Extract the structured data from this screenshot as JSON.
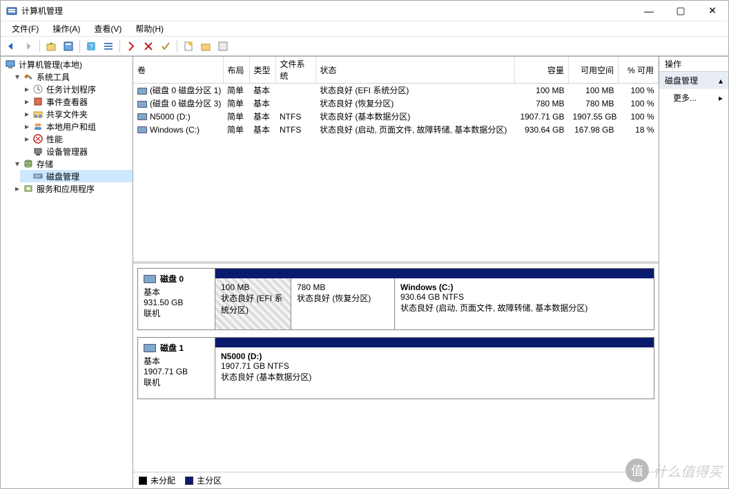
{
  "window": {
    "title": "计算机管理",
    "buttons": {
      "min": "—",
      "max": "▢",
      "close": "✕"
    }
  },
  "menu": {
    "file": "文件(F)",
    "action": "操作(A)",
    "view": "查看(V)",
    "help": "帮助(H)"
  },
  "tree": {
    "root": "计算机管理(本地)",
    "system_tools": "系统工具",
    "task_scheduler": "任务计划程序",
    "event_viewer": "事件查看器",
    "shared_folders": "共享文件夹",
    "local_users": "本地用户和组",
    "performance": "性能",
    "device_manager": "设备管理器",
    "storage": "存储",
    "disk_management": "磁盘管理",
    "services_apps": "服务和应用程序"
  },
  "columns": {
    "volume": "卷",
    "layout": "布局",
    "type": "类型",
    "filesystem": "文件系统",
    "status": "状态",
    "capacity": "容量",
    "free": "可用空间",
    "pct_free": "% 可用"
  },
  "volumes": [
    {
      "name": "(磁盘 0 磁盘分区 1)",
      "layout": "简单",
      "type": "基本",
      "fs": "",
      "status": "状态良好 (EFI 系统分区)",
      "capacity": "100 MB",
      "free": "100 MB",
      "pct": "100 %"
    },
    {
      "name": "(磁盘 0 磁盘分区 3)",
      "layout": "简单",
      "type": "基本",
      "fs": "",
      "status": "状态良好 (恢复分区)",
      "capacity": "780 MB",
      "free": "780 MB",
      "pct": "100 %"
    },
    {
      "name": "N5000 (D:)",
      "layout": "简单",
      "type": "基本",
      "fs": "NTFS",
      "status": "状态良好 (基本数据分区)",
      "capacity": "1907.71 GB",
      "free": "1907.55 GB",
      "pct": "100 %"
    },
    {
      "name": "Windows (C:)",
      "layout": "简单",
      "type": "基本",
      "fs": "NTFS",
      "status": "状态良好 (启动, 页面文件, 故障转储, 基本数据分区)",
      "capacity": "930.64 GB",
      "free": "167.98 GB",
      "pct": "18 %"
    }
  ],
  "disks": [
    {
      "name": "磁盘 0",
      "type": "基本",
      "size": "931.50 GB",
      "status": "联机",
      "parts": [
        {
          "title": "",
          "line1": "100 MB",
          "line2": "状态良好 (EFI 系统分区)",
          "width": 110,
          "hatched": true
        },
        {
          "title": "",
          "line1": "780 MB",
          "line2": "状态良好 (恢复分区)",
          "width": 150,
          "hatched": false
        },
        {
          "title": "Windows  (C:)",
          "line1": "930.64 GB NTFS",
          "line2": "状态良好 (启动, 页面文件, 故障转储, 基本数据分区)",
          "width": 0,
          "hatched": false
        }
      ]
    },
    {
      "name": "磁盘 1",
      "type": "基本",
      "size": "1907.71 GB",
      "status": "联机",
      "parts": [
        {
          "title": "N5000  (D:)",
          "line1": "1907.71 GB NTFS",
          "line2": "状态良好 (基本数据分区)",
          "width": 0,
          "hatched": false
        }
      ]
    }
  ],
  "legend": {
    "unallocated": "未分配",
    "primary": "主分区"
  },
  "actions": {
    "header": "操作",
    "group1": "磁盘管理",
    "more": "更多..."
  },
  "watermark": "什么值得买"
}
